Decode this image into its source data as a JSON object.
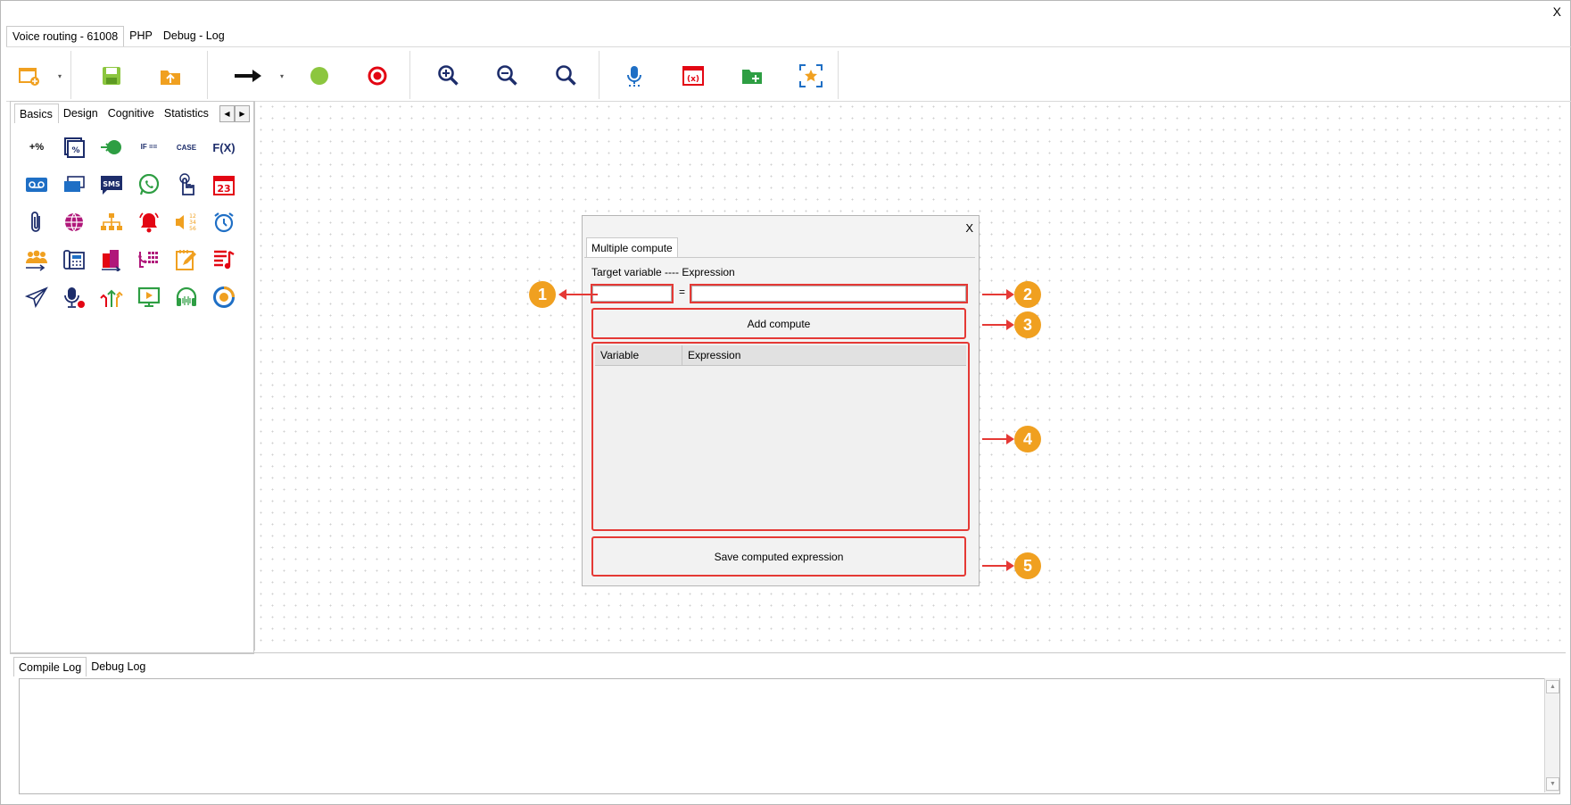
{
  "window": {
    "close_label": "X"
  },
  "doc_tabs": [
    {
      "label": "Voice routing - 61008"
    },
    {
      "label": "PHP"
    },
    {
      "label": "Debug - Log"
    }
  ],
  "toolbar": {
    "buttons": [
      "new-flow-icon",
      "save-icon",
      "upload-icon",
      "arrow-connector-icon",
      "start-node-icon",
      "stop-node-icon",
      "zoom-in-icon",
      "zoom-out-icon",
      "zoom-reset-icon",
      "microphone-icon",
      "variables-icon",
      "add-folder-icon",
      "fit-to-screen-icon"
    ],
    "dropdown_glyph": "▾"
  },
  "palette": {
    "tabs": [
      {
        "label": "Basics"
      },
      {
        "label": "Design"
      },
      {
        "label": "Cognitive"
      },
      {
        "label": "Statistics"
      }
    ],
    "arrow_left": "◀",
    "arrow_right": "▶",
    "icons": [
      "math-operators-icon",
      "percent-calculator-icon",
      "goto-url-icon",
      "if-then-else-icon",
      "case-icon",
      "fx-function-icon",
      "voicemail-icon",
      "cards-icon",
      "sms-icon",
      "whatsapp-icon",
      "dtmf-touch-icon",
      "calendar-icon",
      "attachment-icon",
      "globe-icon",
      "org-chart-icon",
      "alarm-bell-icon",
      "speak-numbers-icon",
      "alarm-clock-icon",
      "agent-group-icon",
      "desk-phone-icon",
      "building-icon",
      "phone-keypad-icon",
      "note-edit-icon",
      "playlist-icon",
      "send-icon",
      "record-icon",
      "split-arrows-icon",
      "video-screen-icon",
      "headset-icon",
      "pie-timer-icon"
    ],
    "text_icons": {
      "fx": "F(X)",
      "sms": "SMS",
      "calendar": "23",
      "if": "IF ==",
      "case": "CASE"
    }
  },
  "dialog": {
    "close_label": "X",
    "tab_label": "Multiple compute",
    "target_label": "Target variable ---- Expression",
    "target_value": "",
    "equals": "=",
    "expression_value": "",
    "add_button": "Add compute",
    "columns": [
      "Variable",
      "Expression"
    ],
    "rows": [],
    "save_button": "Save computed expression"
  },
  "callouts": [
    "1",
    "2",
    "3",
    "4",
    "5"
  ],
  "colors": {
    "callout": "#f0a020",
    "highlight": "#e53935"
  },
  "log": {
    "tabs": [
      {
        "label": "Compile Log"
      },
      {
        "label": "Debug Log"
      }
    ],
    "content": "",
    "scroll_up": "▲",
    "scroll_down": "▼"
  }
}
